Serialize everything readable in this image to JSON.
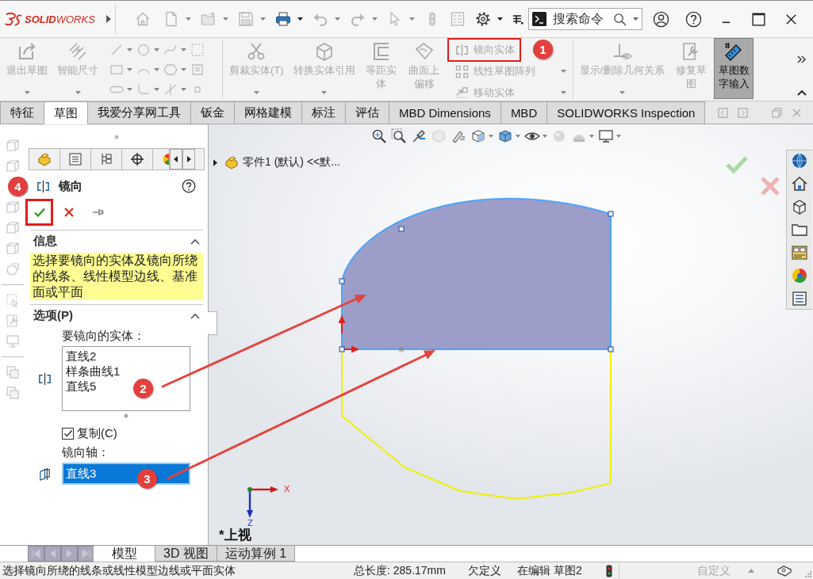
{
  "title_bar": {
    "logo": "**SOLID**WORKS",
    "search": {
      "placeholder": "搜索命令"
    }
  },
  "command_manager": {
    "sketch_buttons": [
      {
        "label": "退出草图",
        "disabled": true,
        "dropdown": true
      },
      {
        "label": "智能尺寸",
        "disabled": true,
        "dropdown": true
      }
    ],
    "edit_buttons": [
      {
        "label": "剪裁实体(T)",
        "disabled": true,
        "dropdown": true
      },
      {
        "label": "转换实体引用",
        "disabled": true,
        "dropdown": true
      },
      {
        "label": "等距实体",
        "disabled": true,
        "dropdown": false
      },
      {
        "label": "曲面上偏移",
        "disabled": true,
        "dropdown": false
      }
    ],
    "stacked_buttons": [
      {
        "label": "镜向实体",
        "disabled": true,
        "dropdown": false,
        "highlighted": true
      },
      {
        "label": "线性草图阵列",
        "disabled": true,
        "dropdown": true,
        "highlighted": false
      },
      {
        "label": "移动实体",
        "disabled": true,
        "dropdown": true,
        "highlighted": false
      }
    ],
    "relation_buttons": [
      {
        "label": "显示/删除几何关系",
        "disabled": true,
        "dropdown": true,
        "pressed": false
      },
      {
        "label": "修复草图",
        "disabled": true,
        "dropdown": false,
        "pressed": false
      },
      {
        "label": "草图数字输入",
        "disabled": false,
        "dropdown": false,
        "pressed": true
      }
    ]
  },
  "tabs": [
    {
      "label": "特征",
      "selected": false
    },
    {
      "label": "草图",
      "selected": true
    },
    {
      "label": "我爱分享网工具",
      "selected": false
    },
    {
      "label": "钣金",
      "selected": false
    },
    {
      "label": "网格建模",
      "selected": false
    },
    {
      "label": "标注",
      "selected": false
    },
    {
      "label": "评估",
      "selected": false
    },
    {
      "label": "MBD Dimensions",
      "selected": false
    },
    {
      "label": "MBD",
      "selected": false
    },
    {
      "label": "SOLIDWORKS Inspection",
      "selected": false
    }
  ],
  "property_manager": {
    "title": "镜向",
    "actions": [
      {
        "kind": "ok",
        "highlighted": true
      },
      {
        "kind": "cancel",
        "highlighted": false
      },
      {
        "kind": "pin",
        "highlighted": false
      }
    ],
    "info": {
      "title": "信息",
      "expanded": true,
      "message": "选择要镜向的实体及镜向所绕的线条、线性模型边线、基准面或平面"
    },
    "options": {
      "title": "选项(P)",
      "expanded": true,
      "entities_label": "要镜向的实体：",
      "entities": [
        "直线2",
        "样条曲线1",
        "直线5"
      ],
      "copy": {
        "label": "复制(C)",
        "checked": true
      },
      "axis_label": "镜向轴：",
      "axis": {
        "value": "直线3",
        "selected": true
      }
    }
  },
  "viewport": {
    "feature_tree": {
      "label": "零件1 (默认) <<默...",
      "expanded": false
    },
    "triad": {
      "x_label": "X",
      "z_label": "Z"
    },
    "view_name": "*上视"
  },
  "model_tabs": [
    {
      "label": "模型",
      "selected": true
    },
    {
      "label": "3D 视图",
      "selected": false
    },
    {
      "label": "运动算例 1",
      "selected": false
    }
  ],
  "status_bar": {
    "message": "选择镜向所绕的线条或线性模型边线或平面实体",
    "total_length": "总长度: 285.17mm",
    "definition": "欠定义",
    "editing": "在编辑 草图2",
    "units": "自定义"
  },
  "callouts": [
    "1",
    "2",
    "3",
    "4"
  ]
}
